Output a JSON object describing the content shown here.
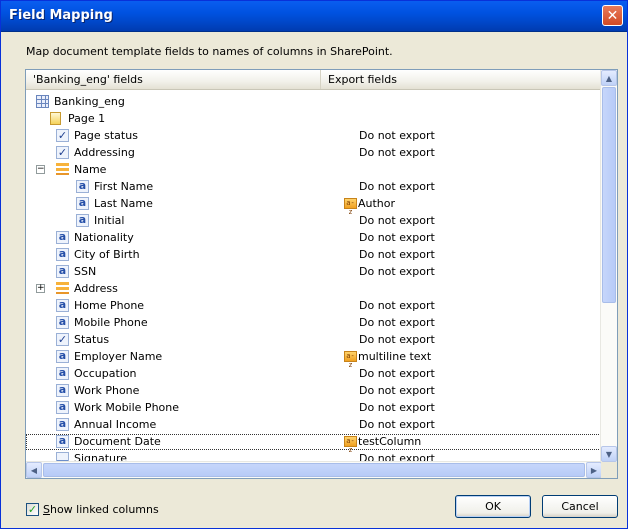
{
  "window": {
    "title": "Field Mapping",
    "close_glyph": "✕"
  },
  "description": "Map document template fields to names of columns in SharePoint.",
  "columns": {
    "fields": "'Banking_eng' fields",
    "export": "Export fields"
  },
  "tree": [
    {
      "label": "Banking_eng",
      "icon": "table-icon",
      "level": 0,
      "expander": "",
      "export": "",
      "linked": false
    },
    {
      "label": "Page 1",
      "icon": "page-icon",
      "level": 0,
      "expander": "−",
      "export": "",
      "linked": false
    },
    {
      "label": "Page status",
      "icon": "checkbox-field-icon",
      "level": 2,
      "expander": "",
      "export": "Do not export",
      "linked": false
    },
    {
      "label": "Addressing",
      "icon": "checkbox-field-icon",
      "level": 2,
      "expander": "",
      "export": "Do not export",
      "linked": false
    },
    {
      "label": "Name",
      "icon": "group-icon",
      "level": 1,
      "expander": "−",
      "export": "",
      "linked": false
    },
    {
      "label": "First Name",
      "icon": "text-field-icon",
      "level": 3,
      "expander": "",
      "export": "Do not export",
      "linked": false
    },
    {
      "label": "Last Name",
      "icon": "text-field-icon",
      "level": 3,
      "expander": "",
      "export": "Author",
      "linked": true
    },
    {
      "label": "Initial",
      "icon": "text-field-icon",
      "level": 3,
      "expander": "",
      "export": "Do not export",
      "linked": false
    },
    {
      "label": "Nationality",
      "icon": "text-field-icon",
      "level": 2,
      "expander": "",
      "export": "Do not export",
      "linked": false
    },
    {
      "label": "City of Birth",
      "icon": "text-field-icon",
      "level": 2,
      "expander": "",
      "export": "Do not export",
      "linked": false
    },
    {
      "label": "SSN",
      "icon": "text-field-icon",
      "level": 2,
      "expander": "",
      "export": "Do not export",
      "linked": false
    },
    {
      "label": "Address",
      "icon": "group-icon",
      "level": 1,
      "expander": "+",
      "export": "",
      "linked": false
    },
    {
      "label": "Home Phone",
      "icon": "text-field-icon",
      "level": 2,
      "expander": "",
      "export": "Do not export",
      "linked": false
    },
    {
      "label": "Mobile Phone",
      "icon": "text-field-icon",
      "level": 2,
      "expander": "",
      "export": "Do not export",
      "linked": false
    },
    {
      "label": "Status",
      "icon": "checkbox-field-icon",
      "level": 2,
      "expander": "",
      "export": "Do not export",
      "linked": false
    },
    {
      "label": "Employer Name",
      "icon": "text-field-icon",
      "level": 2,
      "expander": "",
      "export": "multiline text",
      "linked": true
    },
    {
      "label": "Occupation",
      "icon": "text-field-icon",
      "level": 2,
      "expander": "",
      "export": "Do not export",
      "linked": false
    },
    {
      "label": "Work Phone",
      "icon": "text-field-icon",
      "level": 2,
      "expander": "",
      "export": "Do not export",
      "linked": false
    },
    {
      "label": "Work Mobile Phone",
      "icon": "text-field-icon",
      "level": 2,
      "expander": "",
      "export": "Do not export",
      "linked": false
    },
    {
      "label": "Annual Income",
      "icon": "text-field-icon",
      "level": 2,
      "expander": "",
      "export": "Do not export",
      "linked": false
    },
    {
      "label": "Document Date",
      "icon": "text-field-icon",
      "level": 2,
      "expander": "",
      "export": "testColumn",
      "linked": true,
      "selected": true
    },
    {
      "label": "Signature",
      "icon": "signature-field-icon",
      "level": 2,
      "expander": "",
      "export": "Do not export",
      "linked": false
    }
  ],
  "linked_glyph": "a-z",
  "show_linked": {
    "checked": true,
    "mark": "✓",
    "label_first": "S",
    "label_rest": "how linked columns"
  },
  "buttons": {
    "ok": "OK",
    "cancel": "Cancel"
  }
}
